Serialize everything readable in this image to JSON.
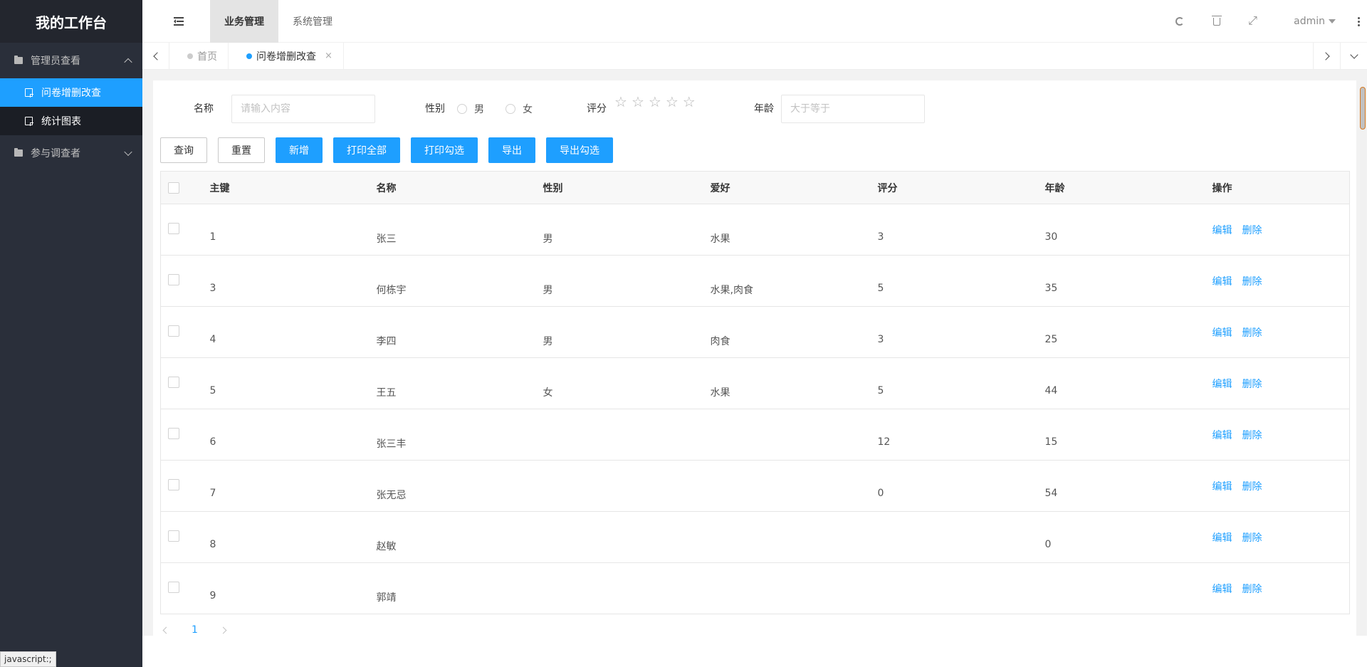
{
  "app": {
    "title": "我的工作台"
  },
  "sidebar": {
    "groups": [
      {
        "label": "管理员查看",
        "items": [
          {
            "label": "问卷增删改查",
            "active": true
          },
          {
            "label": "统计图表",
            "active": false
          }
        ]
      },
      {
        "label": "参与调查者"
      }
    ]
  },
  "header": {
    "nav": [
      {
        "label": "业务管理",
        "active": true
      },
      {
        "label": "系统管理",
        "active": false
      }
    ],
    "user": "admin"
  },
  "tabs": [
    {
      "label": "首页"
    },
    {
      "label": "问卷增删改查",
      "close": "×"
    }
  ],
  "form": {
    "name_label": "名称",
    "name_placeholder": "请输入内容",
    "gender_label": "性别",
    "gender_options": [
      "男",
      "女"
    ],
    "rating_label": "评分",
    "rating_star": "☆",
    "age_label": "年龄",
    "age_placeholder": "大于等于"
  },
  "buttons": {
    "query": "查询",
    "reset": "重置",
    "add": "新增",
    "print_all": "打印全部",
    "print_selected": "打印勾选",
    "export": "导出",
    "export_selected": "导出勾选"
  },
  "table": {
    "columns": [
      "主键",
      "名称",
      "性别",
      "爱好",
      "评分",
      "年龄",
      "操作"
    ],
    "edit_label": "编辑",
    "delete_label": "删除",
    "rows": [
      {
        "id": "1",
        "name": "张三",
        "gender": "男",
        "hobby": "水果",
        "score": "3",
        "age": "30"
      },
      {
        "id": "3",
        "name": "何栋宇",
        "gender": "男",
        "hobby": "水果,肉食",
        "score": "5",
        "age": "35"
      },
      {
        "id": "4",
        "name": "李四",
        "gender": "男",
        "hobby": "肉食",
        "score": "3",
        "age": "25"
      },
      {
        "id": "5",
        "name": "王五",
        "gender": "女",
        "hobby": "水果",
        "score": "5",
        "age": "44"
      },
      {
        "id": "6",
        "name": "张三丰",
        "gender": "",
        "hobby": "",
        "score": "12",
        "age": "15"
      },
      {
        "id": "7",
        "name": "张无忌",
        "gender": "",
        "hobby": "",
        "score": "0",
        "age": "54"
      },
      {
        "id": "8",
        "name": "赵敏",
        "gender": "",
        "hobby": "",
        "score": "",
        "age": "0"
      },
      {
        "id": "9",
        "name": "郭靖",
        "gender": "",
        "hobby": "",
        "score": "",
        "age": ""
      }
    ]
  },
  "pager": {
    "current": "1"
  },
  "status_tip": "javascript:;",
  "colors": {
    "accent": "#1e9fff",
    "sidebar_bg": "#2a2f3a",
    "logo_bg": "#23262e"
  }
}
